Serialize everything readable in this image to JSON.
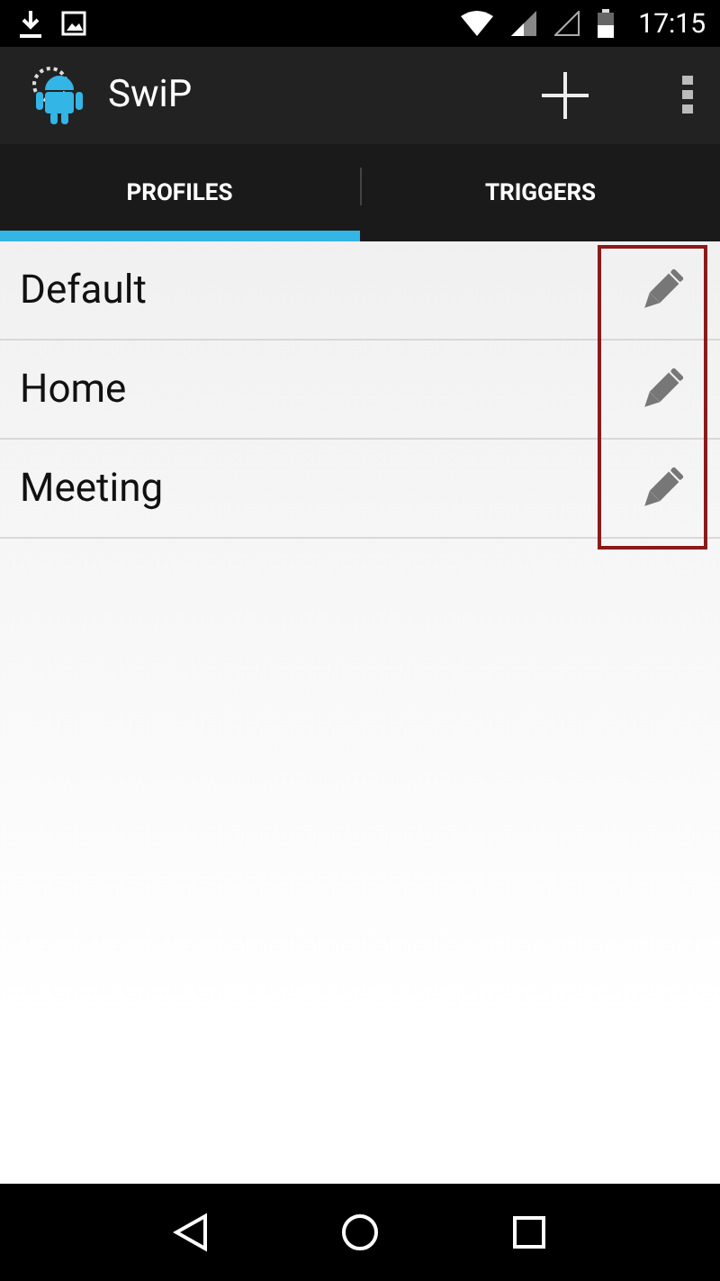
{
  "status_bar": {
    "time": "17:15"
  },
  "app_bar": {
    "title": "SwiP"
  },
  "tabs": [
    {
      "label": "PROFILES",
      "selected": true
    },
    {
      "label": "TRIGGERS",
      "selected": false
    }
  ],
  "profiles": [
    {
      "name": "Default"
    },
    {
      "name": "Home"
    },
    {
      "name": "Meeting"
    }
  ],
  "highlight": {
    "on": true
  }
}
